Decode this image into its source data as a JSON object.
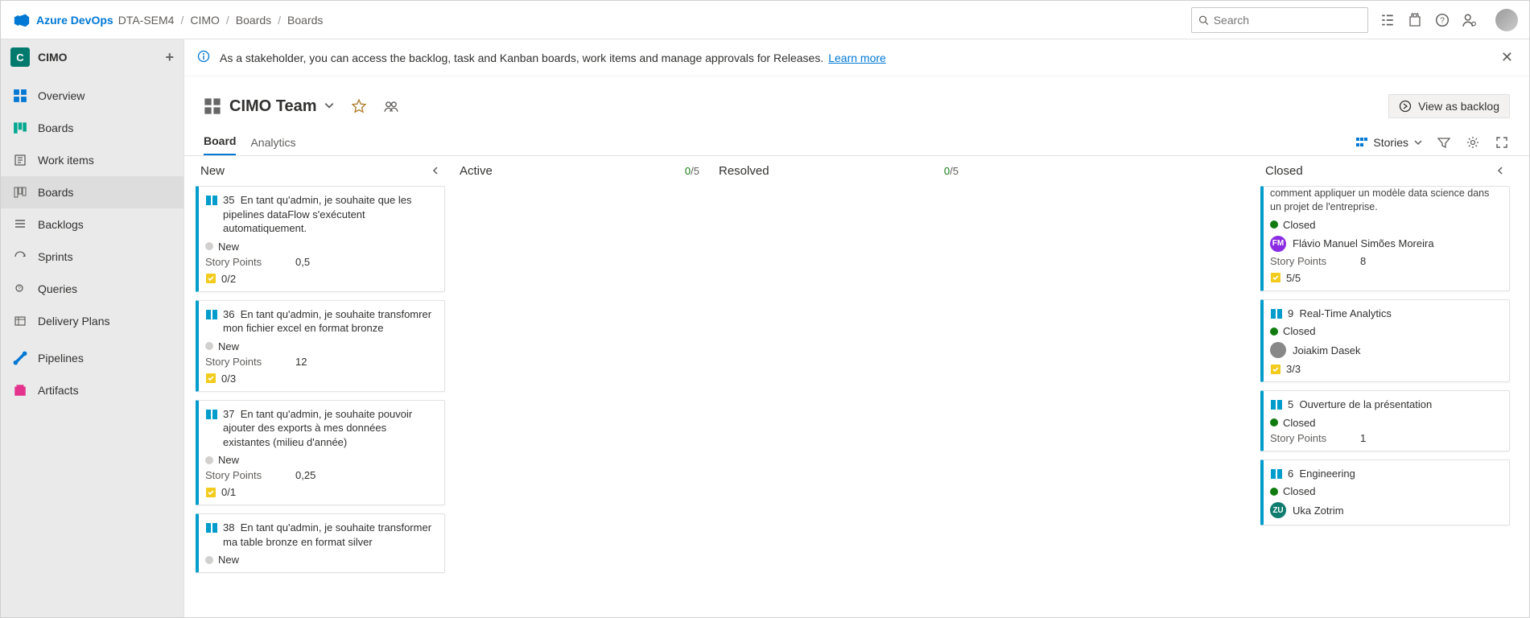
{
  "header": {
    "brand": "Azure DevOps",
    "org": "DTA-SEM4",
    "search_placeholder": "Search",
    "breadcrumb": [
      "CIMO",
      "Boards",
      "Boards"
    ]
  },
  "sidebar": {
    "project_initial": "C",
    "project_name": "CIMO",
    "items": [
      {
        "label": "Overview"
      },
      {
        "label": "Boards"
      },
      {
        "label": "Work items"
      },
      {
        "label": "Boards"
      },
      {
        "label": "Backlogs"
      },
      {
        "label": "Sprints"
      },
      {
        "label": "Queries"
      },
      {
        "label": "Delivery Plans"
      },
      {
        "label": "Pipelines"
      },
      {
        "label": "Artifacts"
      }
    ]
  },
  "info": {
    "text": "As a stakeholder, you can access the backlog, task and Kanban boards, work items and manage approvals for Releases.",
    "link": "Learn more"
  },
  "page": {
    "title": "CIMO Team",
    "backlog_btn": "View as backlog",
    "tabs": [
      "Board",
      "Analytics"
    ],
    "stories_label": "Stories"
  },
  "board": {
    "colors": {
      "story": "#009ccc",
      "task": "#f2cb1d",
      "closed": "#107c10"
    },
    "columns": [
      {
        "key": "new",
        "title": "New",
        "collapse_side": "left",
        "cards": [
          {
            "id": 35,
            "title": "En tant qu'admin, je souhaite que les pipelines dataFlow s'exécutent automatiquement.",
            "state": "New",
            "state_dot": "new",
            "story_points": "0,5",
            "tasks": "0/2"
          },
          {
            "id": 36,
            "title": "En tant qu'admin, je souhaite transfomrer mon fichier excel en format bronze",
            "state": "New",
            "state_dot": "new",
            "story_points": "12",
            "tasks": "0/3"
          },
          {
            "id": 37,
            "title": "En tant qu'admin, je souhaite pouvoir ajouter des exports à mes données existantes (milieu d'année)",
            "state": "New",
            "state_dot": "new",
            "story_points": "0,25",
            "tasks": "0/1"
          },
          {
            "id": 38,
            "title": "En tant qu'admin, je souhaite transformer ma table bronze en format silver",
            "state": "New",
            "state_dot": "new"
          }
        ]
      },
      {
        "key": "active",
        "title": "Active",
        "wip": "0/5",
        "cards": []
      },
      {
        "key": "resolved",
        "title": "Resolved",
        "wip": "0/5",
        "cards": []
      },
      {
        "key": "closed",
        "title": "Closed",
        "collapse_side": "right",
        "partial_top": {
          "text": "comment appliquer un modèle data science dans un projet de l'entreprise.",
          "state": "Closed",
          "state_dot": "closed",
          "assignee": "Flávio Manuel Simões Moreira",
          "av_class": "av-purple",
          "av_txt": "FM",
          "story_points": "8",
          "tasks": "5/5"
        },
        "cards": [
          {
            "id": 9,
            "title": "Real-Time Analytics",
            "state": "Closed",
            "state_dot": "closed",
            "assignee": "Joiakim Dasek",
            "av_class": "av-gray",
            "av_txt": "",
            "tasks": "3/3"
          },
          {
            "id": 5,
            "title": "Ouverture de la présentation",
            "state": "Closed",
            "state_dot": "closed",
            "story_points": "1"
          },
          {
            "id": 6,
            "title": "Engineering",
            "state": "Closed",
            "state_dot": "closed",
            "assignee": "Uka Zotrim",
            "av_class": "av-teal",
            "av_txt": "ZU"
          }
        ]
      }
    ]
  },
  "labels": {
    "story_points": "Story Points"
  }
}
